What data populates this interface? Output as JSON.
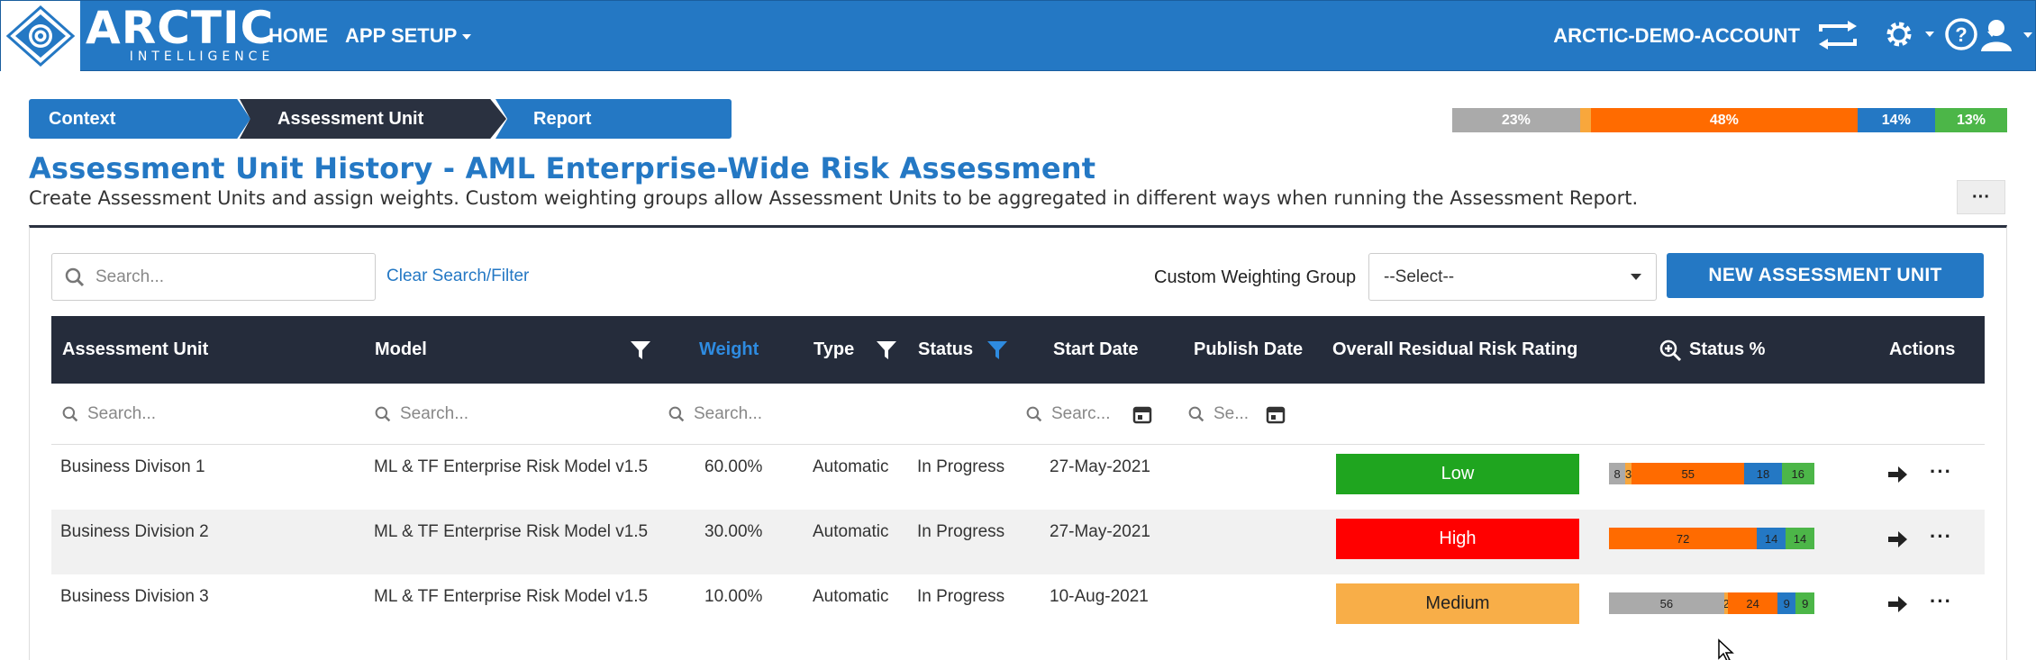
{
  "brand": {
    "name": "ARCTIC",
    "tagline": "INTELLIGENCE",
    "color": "#2478c4"
  },
  "nav": {
    "home": "HOME",
    "app_setup": "APP SETUP"
  },
  "account": {
    "name": "ARCTIC-DEMO-ACCOUNT"
  },
  "icons": {
    "switch": "switch-account-icon",
    "settings": "gear-icon",
    "help": "help-icon",
    "user": "user-icon"
  },
  "wizard": {
    "steps": [
      "Context",
      "Assessment Unit",
      "Report"
    ],
    "active": "Assessment Unit"
  },
  "overall_progress": [
    {
      "label": "23%",
      "value": 23,
      "color": "#aaaaaa"
    },
    {
      "label": "",
      "value": 2,
      "color": "#f8a73c"
    },
    {
      "label": "48%",
      "value": 48,
      "color": "#ff6b00"
    },
    {
      "label": "14%",
      "value": 14,
      "color": "#2478c4"
    },
    {
      "label": "13%",
      "value": 13,
      "color": "#4cb648"
    }
  ],
  "page": {
    "title": "Assessment Unit History - AML Enterprise-Wide Risk Assessment",
    "description": "Create Assessment Units and assign weights. Custom weighting groups allow Assessment Units to be aggregated in different ways when running the Assessment Report.",
    "more": "···"
  },
  "toolbar": {
    "search_placeholder": "Search...",
    "clear_label": "Clear Search/Filter",
    "cwg_label": "Custom Weighting Group",
    "cwg_value": "--Select--",
    "new_button": "NEW ASSESSMENT UNIT"
  },
  "table": {
    "headers": {
      "unit": "Assessment Unit",
      "model": "Model",
      "weight": "Weight",
      "type": "Type",
      "status": "Status",
      "start": "Start Date",
      "publish": "Publish Date",
      "rating": "Overall Residual Risk Rating",
      "status_pct": "Status %",
      "actions": "Actions"
    },
    "search_placeholders": {
      "unit": "Search...",
      "model": "Search...",
      "weight": "Search...",
      "start": "Searc...",
      "publish": "Se..."
    },
    "rows": [
      {
        "unit": "Business Divison 1",
        "model": "ML & TF Enterprise Risk Model v1.5",
        "weight": "60.00%",
        "type": "Automatic",
        "status": "In Progress",
        "start": "27-May-2021",
        "publish": "",
        "rating": "Low",
        "rating_color": "#1fa51f",
        "rating_text_color": "#ffffff",
        "status_pct": [
          {
            "label": "8",
            "value": 8,
            "color": "#aaaaaa"
          },
          {
            "label": "3",
            "value": 3,
            "color": "#f8a73c"
          },
          {
            "label": "55",
            "value": 55,
            "color": "#ff6b00"
          },
          {
            "label": "18",
            "value": 18,
            "color": "#2478c4"
          },
          {
            "label": "16",
            "value": 16,
            "color": "#4cb648"
          }
        ]
      },
      {
        "unit": "Business Division 2",
        "model": "ML & TF Enterprise Risk Model v1.5",
        "weight": "30.00%",
        "type": "Automatic",
        "status": "In Progress",
        "start": "27-May-2021",
        "publish": "",
        "rating": "High",
        "rating_color": "#ff0000",
        "rating_text_color": "#ffffff",
        "status_pct": [
          {
            "label": "72",
            "value": 72,
            "color": "#ff6b00"
          },
          {
            "label": "14",
            "value": 14,
            "color": "#2478c4"
          },
          {
            "label": "14",
            "value": 14,
            "color": "#4cb648"
          }
        ]
      },
      {
        "unit": "Business Division 3",
        "model": "ML & TF Enterprise Risk Model v1.5",
        "weight": "10.00%",
        "type": "Automatic",
        "status": "In Progress",
        "start": "10-Aug-2021",
        "publish": "",
        "rating": "Medium",
        "rating_color": "#f8ae48",
        "rating_text_color": "#222222",
        "status_pct": [
          {
            "label": "56",
            "value": 56,
            "color": "#aaaaaa"
          },
          {
            "label": "2",
            "value": 2,
            "color": "#f8a73c"
          },
          {
            "label": "24",
            "value": 24,
            "color": "#ff6b00"
          },
          {
            "label": "9",
            "value": 9,
            "color": "#2478c4"
          },
          {
            "label": "9",
            "value": 9,
            "color": "#4cb648"
          }
        ]
      }
    ]
  }
}
